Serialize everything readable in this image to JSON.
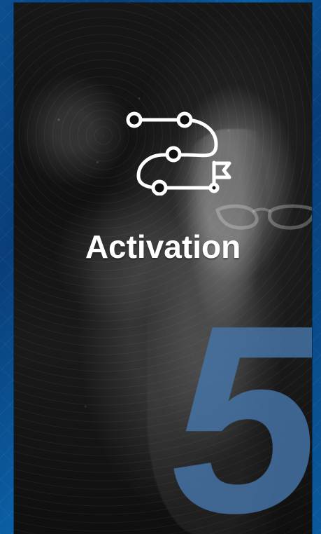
{
  "slide": {
    "title": "Activation",
    "step_number": "5",
    "icon": "route-flag-icon",
    "colors": {
      "outer_background": "#0b4f8f",
      "panel_background": "#151515",
      "title_text": "#ffffff",
      "step_number": "#4171a4"
    }
  }
}
